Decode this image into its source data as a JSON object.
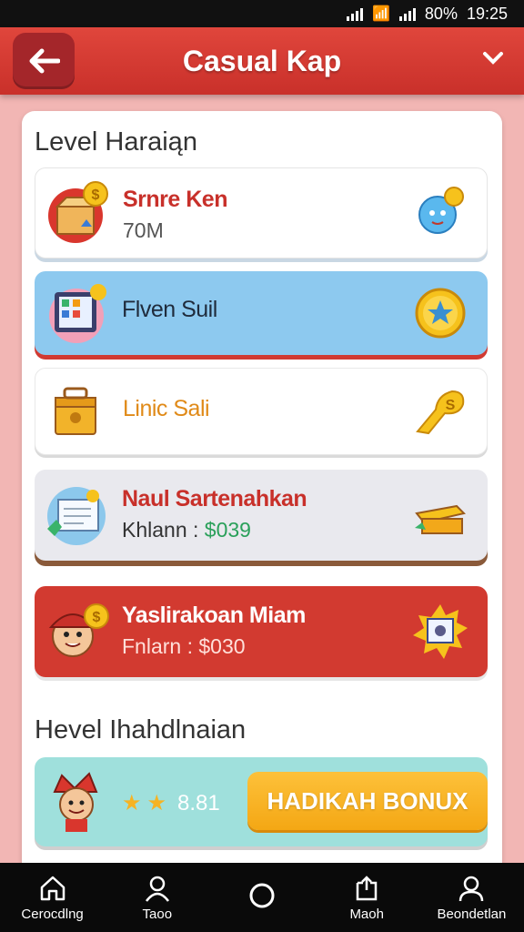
{
  "status": {
    "battery": "80%",
    "time": "19:25"
  },
  "header": {
    "title": "Casual Kap"
  },
  "section1": {
    "title": "Level Haraiąn"
  },
  "cards": [
    {
      "title": "Srnre Ken",
      "sub": "70M",
      "title_color": "#c8302a"
    },
    {
      "title": "Flven Suil",
      "title_color": "#1f2b3c"
    },
    {
      "title": "Linic Sali",
      "title_color": "#e08a18"
    },
    {
      "title": "Naul Sartenahkan",
      "sub_label": "Khlann :",
      "sub_value": "$039",
      "title_color": "#c8302a"
    },
    {
      "title": "Yaslirakoan Miam",
      "sub_label": "Fnlarn :",
      "sub_value": "$030",
      "title_color": "#ffffff"
    }
  ],
  "section2": {
    "title": "Hevel Ihahdlnaian"
  },
  "bonus": {
    "stars_value": "8.81",
    "button": "HADIKAH BONUX"
  },
  "nav": [
    {
      "label": "Cerocdlng",
      "icon": "home-icon"
    },
    {
      "label": "Taoo",
      "icon": "user-icon"
    },
    {
      "label": "",
      "icon": "circle-icon"
    },
    {
      "label": "Maoh",
      "icon": "share-box-icon"
    },
    {
      "label": "Beondetlan",
      "icon": "profile-icon"
    }
  ],
  "colors": {
    "accent": "#d23a30",
    "bonus": "#f6b323",
    "money": "#2aa05a"
  }
}
